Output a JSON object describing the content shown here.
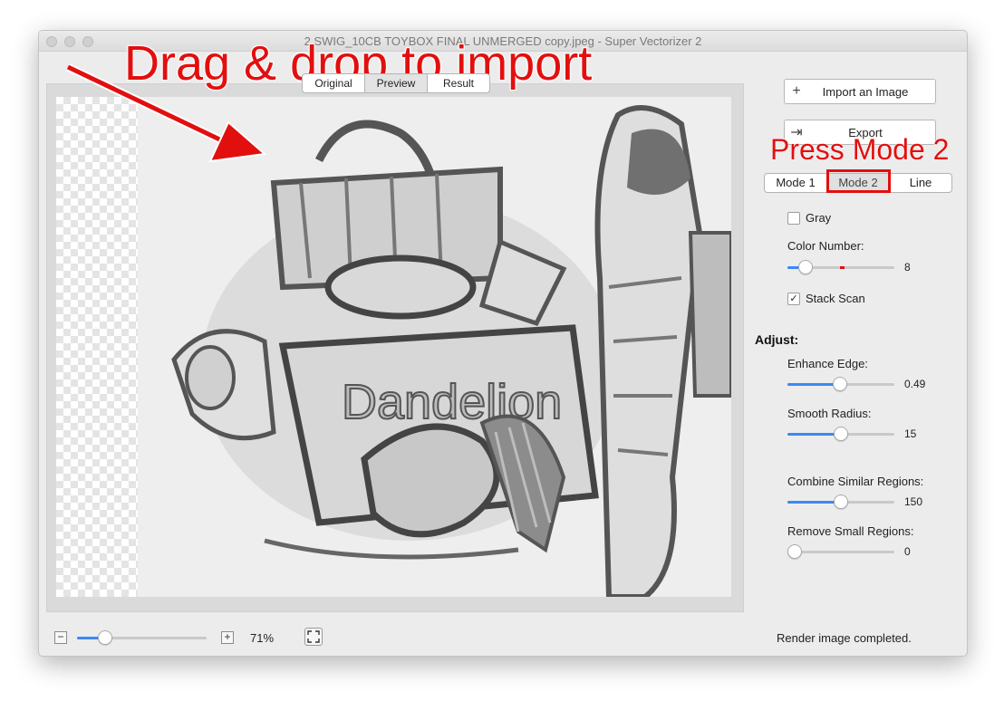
{
  "window": {
    "title": "2.SWIG_10CB TOYBOX FINAL UNMERGED copy.jpeg - Super Vectorizer 2"
  },
  "view_tabs": [
    {
      "label": "Original",
      "active": false
    },
    {
      "label": "Preview",
      "active": true
    },
    {
      "label": "Result",
      "active": false
    }
  ],
  "artwork": {
    "label": "Dandelion"
  },
  "sidebar": {
    "import_label": "Import an Image",
    "export_label": "Export",
    "modes": [
      {
        "label": "Mode 1",
        "active": false
      },
      {
        "label": "Mode 2",
        "active": true
      },
      {
        "label": "Line",
        "active": false
      }
    ],
    "gray": {
      "label": "Gray",
      "checked": false
    },
    "color_number": {
      "label": "Color Number:",
      "value": "8",
      "fraction": 0.12
    },
    "stack_scan": {
      "label": "Stack Scan",
      "checked": true
    },
    "adjust_label": "Adjust:",
    "enhance_edge": {
      "label": "Enhance Edge:",
      "value": "0.49",
      "fraction": 0.49
    },
    "smooth_radius": {
      "label": "Smooth Radius:",
      "value": "15",
      "fraction": 0.5
    },
    "combine_regions": {
      "label": "Combine Similar Regions:",
      "value": "150",
      "fraction": 0.5
    },
    "remove_regions": {
      "label": "Remove Small Regions:",
      "value": "0",
      "fraction": 0.0
    }
  },
  "footer": {
    "zoom_out": "−",
    "zoom_in": "+",
    "zoom_percent": "71%",
    "zoom_fraction": 0.18,
    "status": "Render image completed."
  },
  "annotations": {
    "drag_drop": "Drag & drop to import",
    "press_mode": "Press Mode 2",
    "color": "#e20f0f"
  },
  "colors": {
    "accent": "#3b88f5"
  }
}
